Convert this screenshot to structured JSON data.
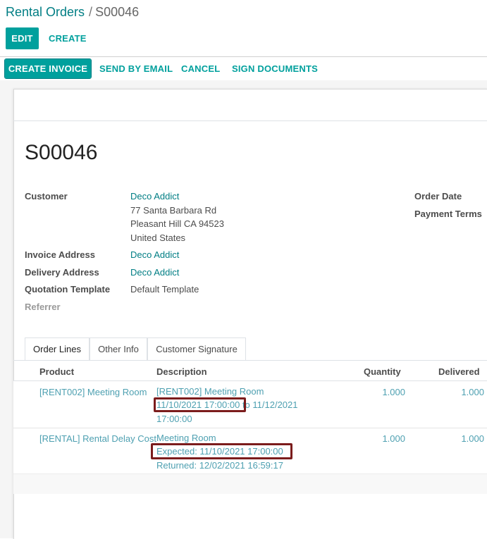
{
  "breadcrumb": {
    "parent": "Rental Orders",
    "separator": "/",
    "current": "S00046"
  },
  "control": {
    "edit_label": "EDIT",
    "create_label": "CREATE"
  },
  "statusbar": {
    "create_invoice": "CREATE INVOICE",
    "send_by_email": "SEND BY EMAIL",
    "cancel": "CANCEL",
    "sign_documents": "SIGN DOCUMENTS"
  },
  "record": {
    "name": "S00046",
    "customer_label": "Customer",
    "customer_name": "Deco Addict",
    "address_line1": "77 Santa Barbara Rd",
    "address_line2": "Pleasant Hill CA 94523",
    "address_line3": "United States",
    "invoice_address_label": "Invoice Address",
    "invoice_address": "Deco Addict",
    "delivery_address_label": "Delivery Address",
    "delivery_address": "Deco Addict",
    "quotation_template_label": "Quotation Template",
    "quotation_template": "Default Template",
    "referrer_label": "Referrer",
    "order_date_label": "Order Date",
    "payment_terms_label": "Payment Terms"
  },
  "tabs": [
    {
      "label": "Order Lines",
      "active": true
    },
    {
      "label": "Other Info",
      "active": false
    },
    {
      "label": "Customer Signature",
      "active": false
    }
  ],
  "order_lines": {
    "headers": {
      "product": "Product",
      "description": "Description",
      "quantity": "Quantity",
      "delivered": "Delivered"
    },
    "rows": [
      {
        "product": "[RENT002] Meeting Room",
        "desc_line1": "[RENT002] Meeting Room",
        "desc_line2a": "11/10/2021 17:00:00",
        "desc_line2b": " to 11/12/2021",
        "desc_line3": "17:00:00",
        "quantity": "1.000",
        "delivered": "1.000"
      },
      {
        "product": "[RENTAL] Rental Delay Cost",
        "desc_line1": "Meeting Room",
        "desc_line2": "Expected: 11/10/2021 17:00:00",
        "desc_line3": "Returned: 12/02/2021 16:59:17",
        "quantity": "1.000",
        "delivered": "1.000"
      }
    ]
  },
  "colors": {
    "brand": "#00a09d",
    "link": "#017e84",
    "highlight": "#7b1c1c"
  }
}
